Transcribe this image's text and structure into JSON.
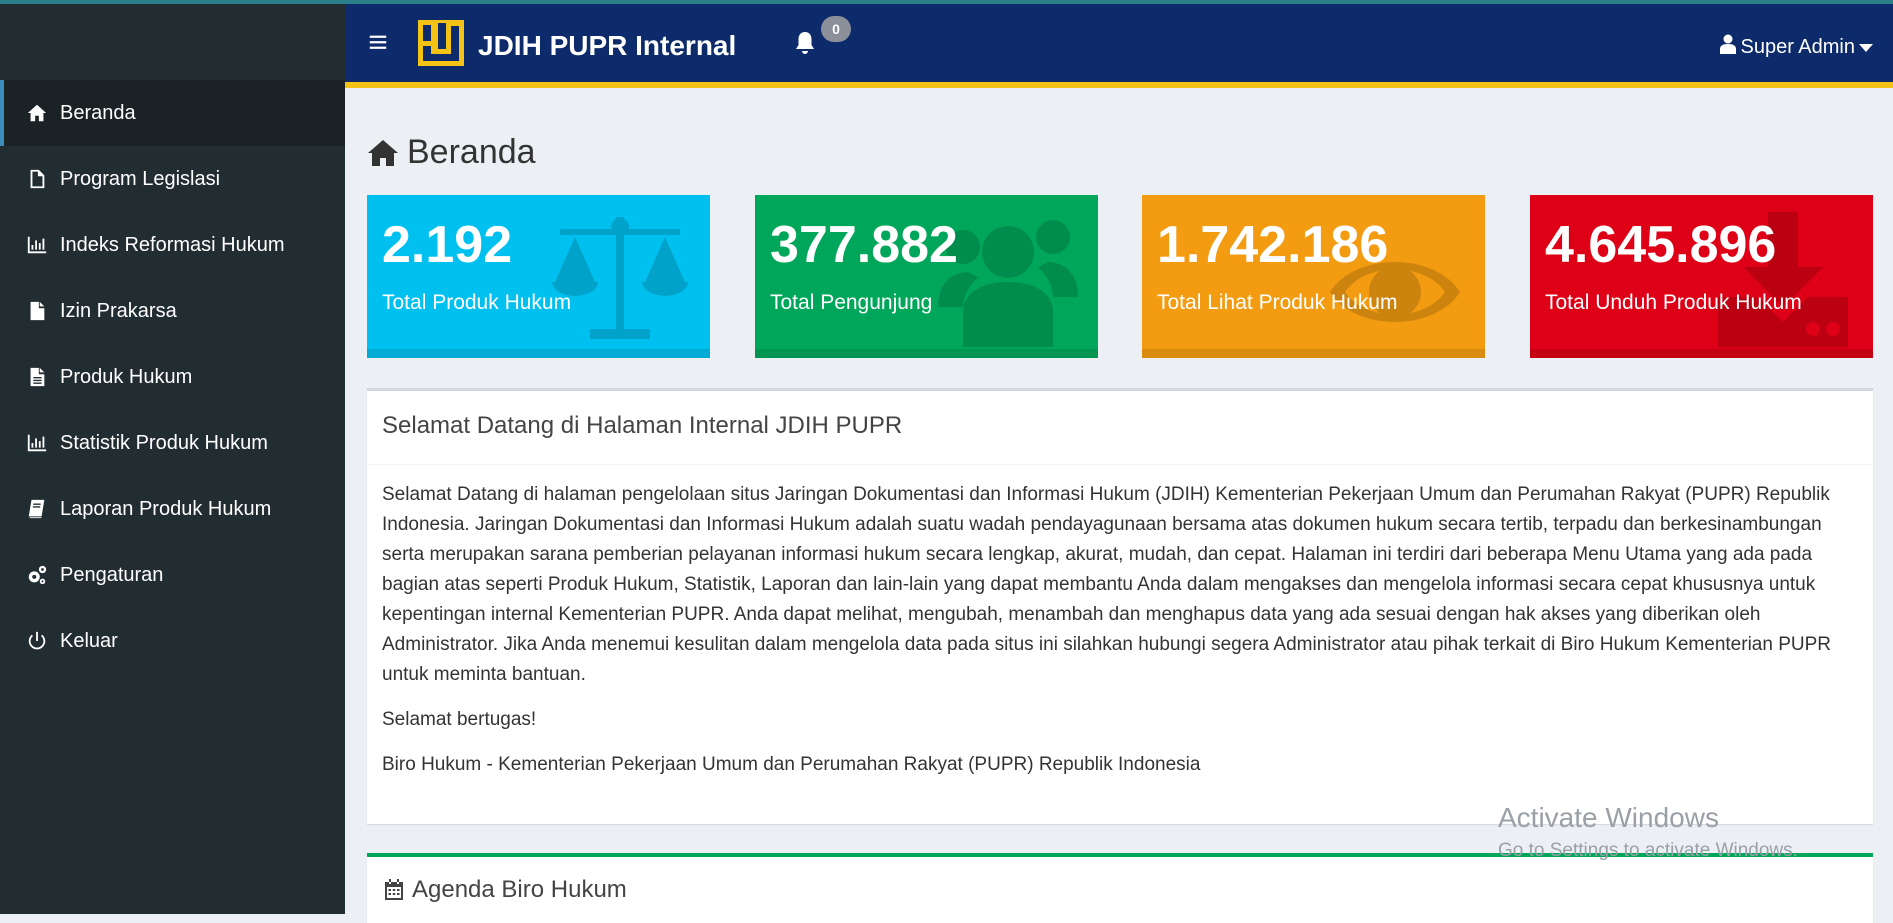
{
  "header": {
    "brand": "JDIH PUPR Internal",
    "notification_count": "0",
    "user_name": "Super Admin"
  },
  "sidebar": {
    "items": [
      {
        "label": "Beranda",
        "icon": "home-icon",
        "active": true
      },
      {
        "label": "Program Legislasi",
        "icon": "file-icon"
      },
      {
        "label": "Indeks Reformasi Hukum",
        "icon": "bar-chart-icon"
      },
      {
        "label": "Izin Prakarsa",
        "icon": "file-solid-icon"
      },
      {
        "label": "Produk Hukum",
        "icon": "file-text-icon"
      },
      {
        "label": "Statistik Produk Hukum",
        "icon": "bar-chart-icon"
      },
      {
        "label": "Laporan Produk Hukum",
        "icon": "book-icon"
      },
      {
        "label": "Pengaturan",
        "icon": "gears-icon"
      },
      {
        "label": "Keluar",
        "icon": "power-icon"
      }
    ]
  },
  "page": {
    "title": "Beranda"
  },
  "stats": [
    {
      "value": "2.192",
      "label": "Total Produk Hukum",
      "color": "#00c0ef",
      "icon": "balance-scale-icon"
    },
    {
      "value": "377.882",
      "label": "Total Pengunjung",
      "color": "#00a65a",
      "icon": "users-icon"
    },
    {
      "value": "1.742.186",
      "label": "Total Lihat Produk Hukum",
      "color": "#f39c12",
      "icon": "eye-icon"
    },
    {
      "value": "4.645.896",
      "label": "Total Unduh Produk Hukum",
      "color": "#dd0016",
      "icon": "download-icon"
    }
  ],
  "welcome": {
    "title": "Selamat Datang di Halaman Internal JDIH PUPR",
    "paragraph": "Selamat Datang di halaman pengelolaan situs Jaringan Dokumentasi dan Informasi Hukum (JDIH) Kementerian Pekerjaan Umum dan Perumahan Rakyat (PUPR) Republik Indonesia. Jaringan Dokumentasi dan Informasi Hukum adalah suatu wadah pendayagunaan bersama atas dokumen hukum secara tertib, terpadu dan berkesinambungan serta merupakan sarana pemberian pelayanan informasi hukum secara lengkap, akurat, mudah, dan cepat. Halaman ini terdiri dari beberapa Menu Utama yang ada pada bagian atas seperti Produk Hukum, Statistik, Laporan dan lain-lain yang dapat membantu Anda dalam mengakses dan mengelola informasi secara cepat khususnya untuk kepentingan internal Kementerian PUPR. Anda dapat melihat, mengubah, menambah dan menghapus data yang ada sesuai dengan hak akses yang diberikan oleh Administrator. Jika Anda menemui kesulitan dalam mengelola data pada situs ini silahkan hubungi segera Administrator atau pihak terkait di Biro Hukum Kementerian PUPR untuk meminta bantuan.",
    "greeting": "Selamat bertugas!",
    "signature": "Biro Hukum - Kementerian Pekerjaan Umum dan Perumahan Rakyat (PUPR) Republik Indonesia"
  },
  "agenda": {
    "title": "Agenda Biro Hukum"
  },
  "watermark": {
    "line1": "Activate Windows",
    "line2": "Go to Settings to activate Windows."
  }
}
